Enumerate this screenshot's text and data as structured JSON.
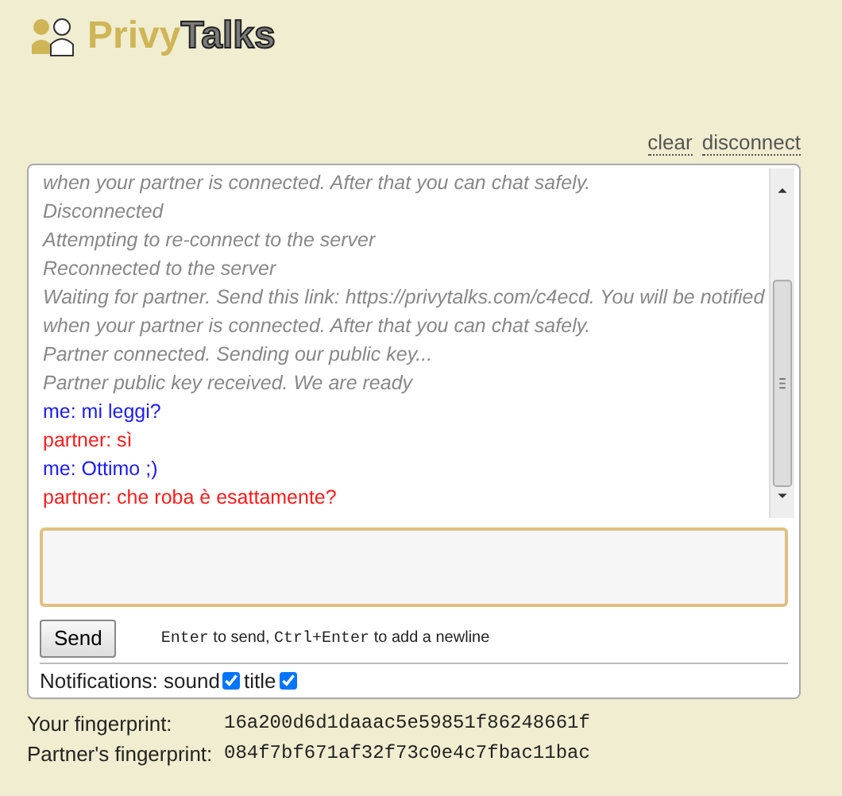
{
  "logo": {
    "part_1": "Privy",
    "part_2": "Talks"
  },
  "links": [
    "clear",
    "disconnect"
  ],
  "messages": [
    {
      "kind": "system",
      "text": "when your partner is connected. After that you can chat safely."
    },
    {
      "kind": "system",
      "text": "Disconnected"
    },
    {
      "kind": "system",
      "text": "Attempting to re-connect to the server"
    },
    {
      "kind": "system",
      "text": "Reconnected to the server"
    },
    {
      "kind": "system",
      "text": "Waiting for partner. Send this link: https://privytalks.com/c4ecd. You will be notified when your partner is connected. After that you can chat safely."
    },
    {
      "kind": "system",
      "text": "Partner connected. Sending our public key..."
    },
    {
      "kind": "system",
      "text": "Partner public key received. We are ready"
    },
    {
      "kind": "me",
      "text": "me: mi leggi?"
    },
    {
      "kind": "partner",
      "text": "partner: sì"
    },
    {
      "kind": "me",
      "text": "me: Ottimo ;)"
    },
    {
      "kind": "partner",
      "text": "partner: che roba è esattamente?"
    }
  ],
  "send_button": "Send",
  "hint": {
    "key_1": "Enter",
    "text_1": "to send,",
    "key_2": "Ctrl+Enter",
    "text_2": "to add a newline"
  },
  "notifications": {
    "label": "Notifications:",
    "options": [
      {
        "label": "sound",
        "checked": true
      },
      {
        "label": "title",
        "checked": true
      }
    ]
  },
  "fingerprints": [
    {
      "label": "Your fingerprint:",
      "value": "16a200d6d1daaac5e59851f86248661f"
    },
    {
      "label": "Partner's fingerprint:",
      "value": "084f7bf671af32f73c0e4c7fbac11bac"
    }
  ]
}
